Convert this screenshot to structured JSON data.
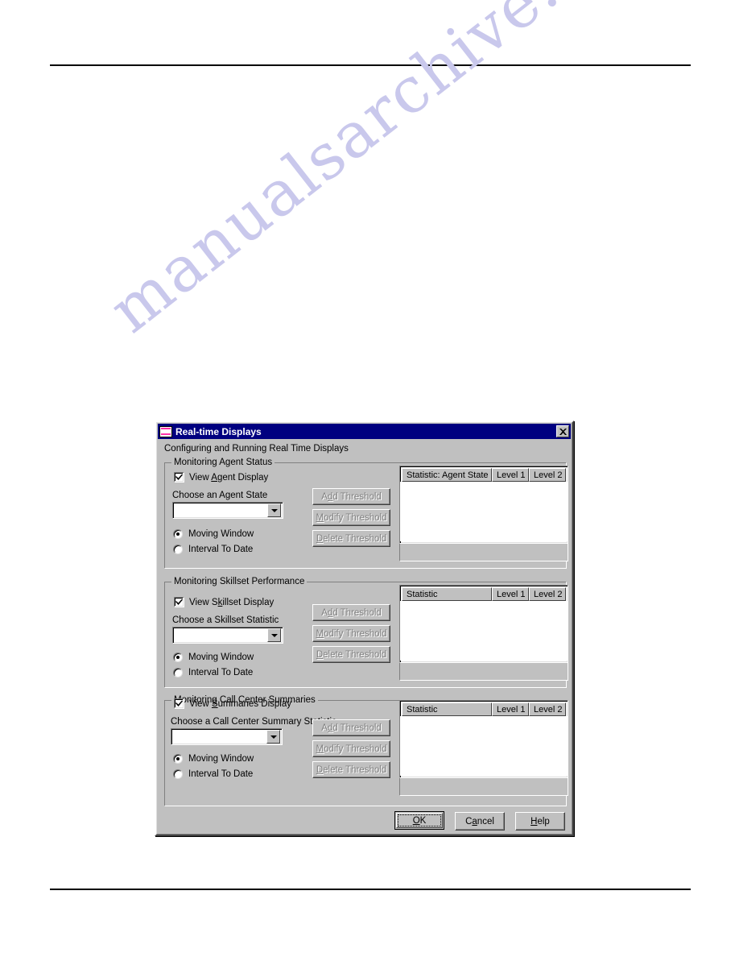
{
  "page": {
    "watermark_text": "manualsarchive.com"
  },
  "dialog": {
    "title": "Real-time Displays",
    "close_icon": "close-icon",
    "app_icon": "realtime-display-icon",
    "subtitle": "Configuring and Running Real Time Displays",
    "sections": [
      {
        "legend": "Monitoring Agent Status",
        "checkbox_label_pre": "View ",
        "checkbox_accel": "A",
        "checkbox_label_post": "gent Display",
        "checkbox_checked": true,
        "field_label": "Choose an Agent State",
        "combo_value": "",
        "radio_moving": "Moving Window",
        "radio_interval": "Interval To Date",
        "radio_selected": "Moving Window",
        "buttons": [
          {
            "pre": "A",
            "accel": "d",
            "post": "d Threshold",
            "full": "Add Threshold",
            "enabled": false
          },
          {
            "pre": "",
            "accel": "M",
            "post": "odify Threshold",
            "full": "Modify Threshold",
            "enabled": false
          },
          {
            "pre": "",
            "accel": "D",
            "post": "elete Threshold",
            "full": "Delete Threshold",
            "enabled": false
          }
        ],
        "columns": [
          "Statistic: Agent State",
          "Level 1",
          "Level 2"
        ],
        "rows": []
      },
      {
        "legend": "Monitoring Skillset Performance",
        "checkbox_label_pre": "View S",
        "checkbox_accel": "k",
        "checkbox_label_post": "illset Display",
        "checkbox_checked": true,
        "field_label": "Choose a Skillset Statistic",
        "combo_value": "",
        "radio_moving": "Moving Window",
        "radio_interval": "Interval To Date",
        "radio_selected": "Moving Window",
        "buttons": [
          {
            "pre": "A",
            "accel": "d",
            "post": "d Threshold",
            "full": "Add Threshold",
            "enabled": false
          },
          {
            "pre": "",
            "accel": "M",
            "post": "odify Threshold",
            "full": "Modify Threshold",
            "enabled": false
          },
          {
            "pre": "",
            "accel": "D",
            "post": "elete Threshold",
            "full": "Delete Threshold",
            "enabled": false
          }
        ],
        "columns": [
          "Statistic",
          "Level 1",
          "Level 2"
        ],
        "rows": []
      },
      {
        "legend": "Monitoring Call Center Summaries",
        "checkbox_label_pre": "View ",
        "checkbox_accel": "S",
        "checkbox_label_post": "ummaries Display",
        "checkbox_checked": true,
        "field_label": "Choose a Call Center Summary Statistic",
        "combo_value": "",
        "radio_moving": "Moving Window",
        "radio_interval": "Interval To Date",
        "radio_selected": "Moving Window",
        "buttons": [
          {
            "pre": "A",
            "accel": "d",
            "post": "d Threshold",
            "full": "Add Threshold",
            "enabled": false
          },
          {
            "pre": "",
            "accel": "M",
            "post": "odify Threshold",
            "full": "Modify Threshold",
            "enabled": false
          },
          {
            "pre": "",
            "accel": "D",
            "post": "elete Threshold",
            "full": "Delete Threshold",
            "enabled": false
          }
        ],
        "columns": [
          "Statistic",
          "Level 1",
          "Level 2"
        ],
        "rows": []
      }
    ],
    "command_buttons": [
      {
        "pre": "",
        "accel": "O",
        "post": "K",
        "full": "OK",
        "default": true
      },
      {
        "pre": "C",
        "accel": "a",
        "post": "ncel",
        "full": "Cancel",
        "default": false
      },
      {
        "pre": "",
        "accel": "H",
        "post": "elp",
        "full": "Help",
        "default": false
      }
    ]
  }
}
